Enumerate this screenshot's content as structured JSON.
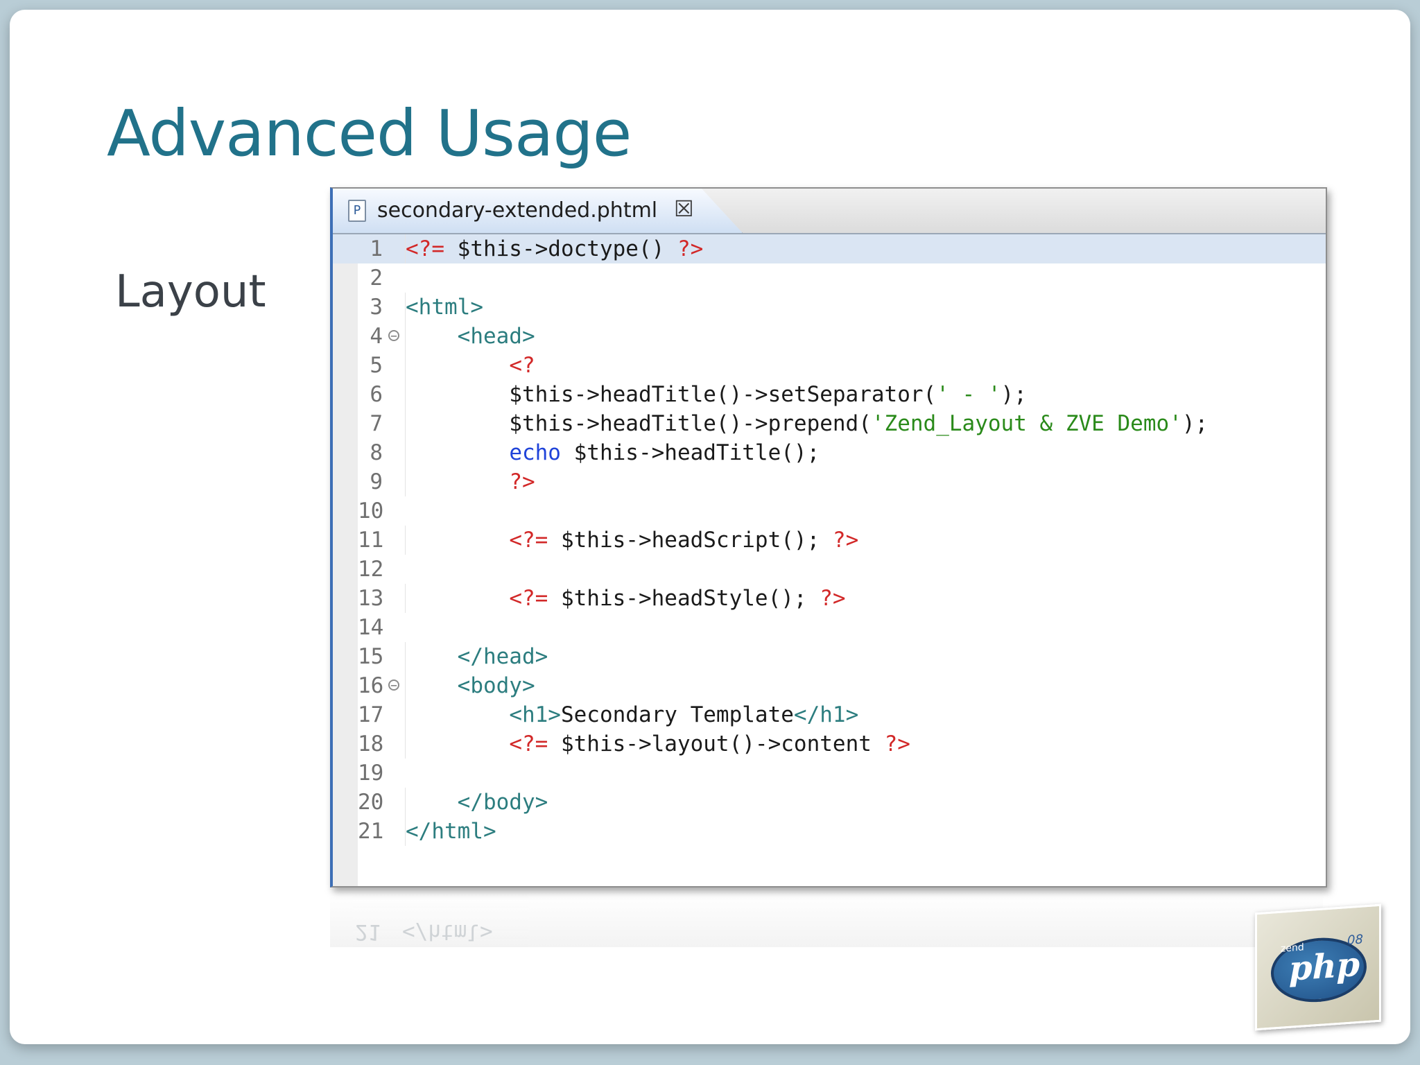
{
  "slide": {
    "title": "Advanced Usage",
    "bullet": "Layout"
  },
  "editor": {
    "tab": {
      "file_icon": "P",
      "filename": "secondary-extended.phtml",
      "close_icon": "close-icon"
    },
    "lines": [
      {
        "num": "1",
        "tokens": [
          [
            "php",
            "<?= "
          ],
          [
            "plain",
            "$this->doctype() "
          ],
          [
            "php",
            "?>"
          ]
        ]
      },
      {
        "num": "2",
        "tokens": []
      },
      {
        "num": "3",
        "tokens": [
          [
            "tag",
            "<html>"
          ]
        ]
      },
      {
        "num": "4",
        "fold": true,
        "tokens": [
          [
            "plain",
            "    "
          ],
          [
            "tag",
            "<head>"
          ]
        ]
      },
      {
        "num": "5",
        "tokens": [
          [
            "plain",
            "        "
          ],
          [
            "php",
            "<?"
          ]
        ]
      },
      {
        "num": "6",
        "tokens": [
          [
            "plain",
            "        $this->headTitle()->setSeparator("
          ],
          [
            "str",
            "' - '"
          ],
          [
            "plain",
            ");"
          ]
        ]
      },
      {
        "num": "7",
        "tokens": [
          [
            "plain",
            "        $this->headTitle()->prepend("
          ],
          [
            "str",
            "'Zend_Layout & ZVE Demo'"
          ],
          [
            "plain",
            ");"
          ]
        ]
      },
      {
        "num": "8",
        "tokens": [
          [
            "plain",
            "        "
          ],
          [
            "kw",
            "echo"
          ],
          [
            "plain",
            " $this->headTitle();"
          ]
        ]
      },
      {
        "num": "9",
        "tokens": [
          [
            "plain",
            "        "
          ],
          [
            "php",
            "?>"
          ]
        ]
      },
      {
        "num": "10",
        "tokens": []
      },
      {
        "num": "11",
        "tokens": [
          [
            "plain",
            "        "
          ],
          [
            "php",
            "<?= "
          ],
          [
            "plain",
            "$this->headScript(); "
          ],
          [
            "php",
            "?>"
          ]
        ]
      },
      {
        "num": "12",
        "tokens": []
      },
      {
        "num": "13",
        "tokens": [
          [
            "plain",
            "        "
          ],
          [
            "php",
            "<?= "
          ],
          [
            "plain",
            "$this->headStyle(); "
          ],
          [
            "php",
            "?>"
          ]
        ]
      },
      {
        "num": "14",
        "tokens": []
      },
      {
        "num": "15",
        "tokens": [
          [
            "plain",
            "    "
          ],
          [
            "tag",
            "</head>"
          ]
        ]
      },
      {
        "num": "16",
        "fold": true,
        "tokens": [
          [
            "plain",
            "    "
          ],
          [
            "tag",
            "<body>"
          ]
        ]
      },
      {
        "num": "17",
        "tokens": [
          [
            "plain",
            "        "
          ],
          [
            "tag",
            "<h1>"
          ],
          [
            "plain",
            "Secondary Template"
          ],
          [
            "tag",
            "</h1>"
          ]
        ]
      },
      {
        "num": "18",
        "tokens": [
          [
            "plain",
            "        "
          ],
          [
            "php",
            "<?= "
          ],
          [
            "plain",
            "$this->layout()->content "
          ],
          [
            "php",
            "?>"
          ]
        ]
      },
      {
        "num": "19",
        "tokens": []
      },
      {
        "num": "20",
        "tokens": [
          [
            "plain",
            "    "
          ],
          [
            "tag",
            "</body>"
          ]
        ]
      },
      {
        "num": "21",
        "tokens": [
          [
            "tag",
            "</html>"
          ]
        ]
      }
    ],
    "current_line": 1
  },
  "reflection": {
    "num": "21",
    "text": "</html>"
  },
  "logo": {
    "small": "zend",
    "main": "php",
    "year": "08"
  },
  "colors": {
    "title": "#21728a",
    "php_delimiter": "#d22828",
    "html_tag": "#2c7d7f",
    "string": "#2a8a1a",
    "keyword": "#1f43d9",
    "current_line": "#dae5f3"
  }
}
